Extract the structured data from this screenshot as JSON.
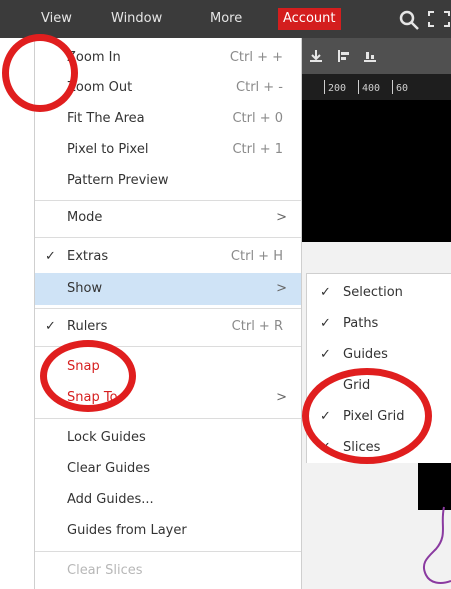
{
  "menubar": {
    "items": [
      "View",
      "Window",
      "More"
    ],
    "account_label": "Account",
    "search_icon": "search-icon",
    "expand_icon": "fullscreen-icon",
    "account_color": "#d41e1e"
  },
  "ruler": {
    "labels": [
      "200",
      "400",
      "60"
    ]
  },
  "view_menu": {
    "zoom_in": {
      "label": "Zoom In",
      "shortcut": "Ctrl + +"
    },
    "zoom_out": {
      "label": "Zoom Out",
      "shortcut": "Ctrl + -"
    },
    "fit_area": {
      "label": "Fit The Area",
      "shortcut": "Ctrl + 0"
    },
    "pixel_to_pixel": {
      "label": "Pixel to Pixel",
      "shortcut": "Ctrl + 1"
    },
    "pattern_preview": {
      "label": "Pattern Preview"
    },
    "mode": {
      "label": "Mode",
      "arrow": ">"
    },
    "extras": {
      "label": "Extras",
      "shortcut": "Ctrl + H",
      "check": "✓"
    },
    "show": {
      "label": "Show",
      "arrow": ">"
    },
    "rulers": {
      "label": "Rulers",
      "shortcut": "Ctrl + R",
      "check": "✓"
    },
    "snap": {
      "label": "Snap"
    },
    "snap_to": {
      "label": "Snap To",
      "arrow": ">"
    },
    "lock_guides": {
      "label": "Lock Guides"
    },
    "clear_guides": {
      "label": "Clear Guides"
    },
    "add_guides": {
      "label": "Add Guides..."
    },
    "guides_from_layer": {
      "label": "Guides from Layer"
    },
    "clear_slices": {
      "label": "Clear Slices"
    }
  },
  "show_submenu": {
    "selection": {
      "label": "Selection",
      "check": "✓"
    },
    "paths": {
      "label": "Paths",
      "check": "✓"
    },
    "guides": {
      "label": "Guides",
      "check": "✓"
    },
    "grid": {
      "label": "Grid"
    },
    "pixel_grid": {
      "label": "Pixel Grid",
      "check": "✓"
    },
    "slices": {
      "label": "Slices",
      "check": "✓"
    }
  },
  "colors": {
    "highlight": "#cfe3f6",
    "annotation_red": "#e01e1e",
    "menubar_bg": "#3b3b3b"
  }
}
